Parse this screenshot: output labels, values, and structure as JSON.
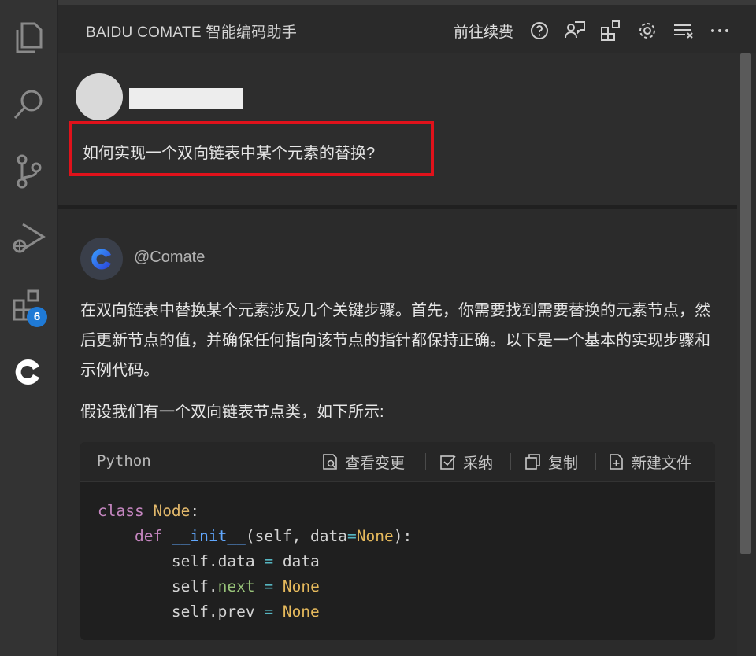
{
  "header": {
    "title": "BAIDU COMATE 智能编码助手",
    "renew_link": "前往续费",
    "icons": [
      "help-icon",
      "feedback-icon",
      "extensions-icon",
      "settings-icon",
      "clear-icon",
      "more-icon"
    ]
  },
  "activity_bar": {
    "items": [
      "explorer-icon",
      "search-icon",
      "source-control-icon",
      "run-debug-icon",
      "extensions-icon",
      "comate-icon"
    ],
    "extensions_badge": "6"
  },
  "user_message": {
    "question": "如何实现一个双向链表中某个元素的替换?"
  },
  "reply": {
    "bot_name": "@Comate",
    "paragraph1": "在双向链表中替换某个元素涉及几个关键步骤。首先，你需要找到需要替换的元素节点，然后更新节点的值，并确保任何指向该节点的指针都保持正确。以下是一个基本的实现步骤和示例代码。",
    "paragraph2": "假设我们有一个双向链表节点类，如下所示:",
    "code": {
      "language": "Python",
      "actions": [
        "查看变更",
        "采纳",
        "复制",
        "新建文件"
      ]
    }
  },
  "colors": {
    "highlight_border": "#e0121b",
    "badge": "#1f7ad6",
    "keyword": "#c586c0",
    "class_name": "#e2b86b",
    "function": "#61a8ff"
  }
}
